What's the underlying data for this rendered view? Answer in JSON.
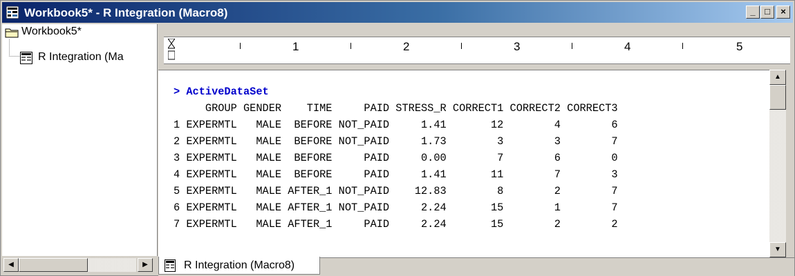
{
  "window": {
    "title": "Workbook5* - R Integration (Macro8)",
    "controls": {
      "minimize": "_",
      "restore": "□",
      "close": "×"
    }
  },
  "tree": {
    "root_label": "Workbook5*",
    "child_label": "R Integration (Ma"
  },
  "ruler": {
    "numbers": [
      "1",
      "2",
      "3",
      "4",
      "5"
    ]
  },
  "console": {
    "command": "> ActiveDataSet",
    "header": "     GROUP GENDER    TIME     PAID STRESS_R CORRECT1 CORRECT2 CORRECT3",
    "rows": [
      "1 EXPERMTL   MALE  BEFORE NOT_PAID     1.41       12        4        6",
      "2 EXPERMTL   MALE  BEFORE NOT_PAID     1.73        3        3        7",
      "3 EXPERMTL   MALE  BEFORE     PAID     0.00        7        6        0",
      "4 EXPERMTL   MALE  BEFORE     PAID     1.41       11        7        3",
      "5 EXPERMTL   MALE AFTER_1 NOT_PAID    12.83        8        2        7",
      "6 EXPERMTL   MALE AFTER_1 NOT_PAID     2.24       15        1        7",
      "7 EXPERMTL   MALE AFTER_1     PAID     2.24       15        2        2"
    ]
  },
  "tab": {
    "label": "R Integration (Macro8)"
  },
  "colors": {
    "title_gradient_start": "#0a246a",
    "title_gradient_end": "#a6caf0",
    "prompt": "#0000cc"
  },
  "icons": {
    "title": "workbook-icon",
    "folder": "folder-icon",
    "sheet": "sheet-icon"
  }
}
